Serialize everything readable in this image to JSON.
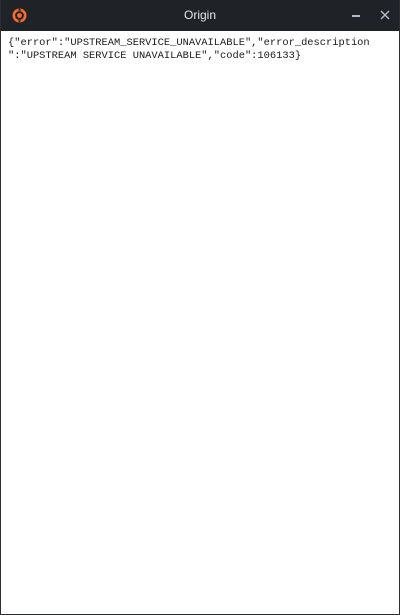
{
  "window": {
    "title": "Origin",
    "icon": "origin-logo-icon",
    "controls": {
      "minimize_icon": "minimize-icon",
      "close_icon": "close-icon"
    }
  },
  "content": {
    "response_line_1": "{\"error\":\"UPSTREAM_SERVICE_UNAVAILABLE\",\"error_description",
    "response_line_2": "\":\"UPSTREAM SERVICE UNAVAILABLE\",\"code\":106133}"
  },
  "colors": {
    "titlebar_bg": "#1f2328",
    "title_text": "#e6e6e6",
    "brand_orange": "#f56c2d",
    "content_bg": "#ffffff",
    "content_text": "#1a1a1a"
  }
}
